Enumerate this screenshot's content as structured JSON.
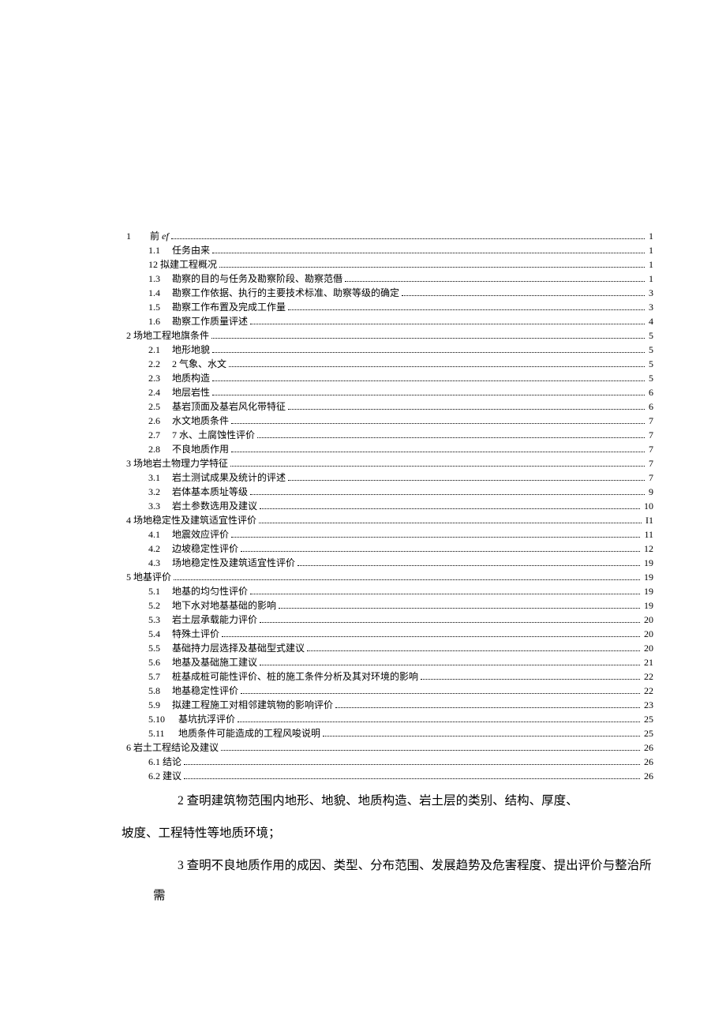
{
  "toc": [
    {
      "num": "1",
      "label": "前 <em>ef</em>",
      "page": "1",
      "lvl": 0
    },
    {
      "num": "1.1",
      "label": "任务由来",
      "page": "1",
      "lvl": 1
    },
    {
      "num": "",
      "label": "12 拟建工程概况",
      "page": "1",
      "lvl": 1
    },
    {
      "num": "1.3",
      "label": "勘察的目的与任务及勘察阶段、勘察范僭",
      "page": "1",
      "lvl": 1
    },
    {
      "num": "1.4",
      "label": "勘察工作依据、执行的主要技术标准、助察等级的确定",
      "page": "3",
      "lvl": 1
    },
    {
      "num": "1.5",
      "label": "勘察工作布置及完成工作量",
      "page": "3",
      "lvl": 1
    },
    {
      "num": "1.6",
      "label": "勘察工作质量评述",
      "page": "4",
      "lvl": 1
    },
    {
      "num": "",
      "label": "2 场地工程地旗条件",
      "page": "5",
      "lvl": 0
    },
    {
      "num": "2.1",
      "label": "地形地貌",
      "page": "5",
      "lvl": 1
    },
    {
      "num": "2.2",
      "label": "2 气象、水文",
      "page": "5",
      "lvl": 1
    },
    {
      "num": "2.3",
      "label": "地质构造",
      "page": "5",
      "lvl": 1
    },
    {
      "num": "2.4",
      "label": "地层岩性",
      "page": "6",
      "lvl": 1
    },
    {
      "num": "2.5",
      "label": "基岩顶面及基岩风化带特征",
      "page": "6",
      "lvl": 1
    },
    {
      "num": "2.6",
      "label": "水文地质条件",
      "page": "7",
      "lvl": 1
    },
    {
      "num": "2.7",
      "label": "7 水、土腐蚀性评价",
      "page": "7",
      "lvl": 1
    },
    {
      "num": "2.8",
      "label": "不良地质作用",
      "page": "7",
      "lvl": 1
    },
    {
      "num": "",
      "label": "3 场地岩土物理力学特征",
      "page": "7",
      "lvl": 0
    },
    {
      "num": "3.1",
      "label": "岩土测试成果及统计的评述",
      "page": "7",
      "lvl": 1
    },
    {
      "num": "3.2",
      "label": "岩体基本质址等级",
      "page": "9",
      "lvl": 1
    },
    {
      "num": "3.3",
      "label": "岩土参数选用及建议",
      "page": "10",
      "lvl": 1
    },
    {
      "num": "",
      "label": "4 场地稳定性及建筑适宜性评价",
      "page": "I1",
      "lvl": 0
    },
    {
      "num": "4.1",
      "label": "地震效应评价",
      "page": "11",
      "lvl": 1
    },
    {
      "num": "4.2",
      "label": "边坡稳定性评价",
      "page": "12",
      "lvl": 1
    },
    {
      "num": "4.3",
      "label": "场地稳定性及建筑适宜性评价",
      "page": "19",
      "lvl": 1
    },
    {
      "num": "",
      "label": "5 地基评价",
      "page": "19",
      "lvl": 0
    },
    {
      "num": "5.1",
      "label": "地基的均匀性评价",
      "page": "19",
      "lvl": 1
    },
    {
      "num": "5.2",
      "label": "地下水对地基基础的影响",
      "page": "19",
      "lvl": 1
    },
    {
      "num": "5.3",
      "label": "岩土层承载能力评价",
      "page": "20",
      "lvl": 1
    },
    {
      "num": "5.4",
      "label": "特殊土评价",
      "page": "20",
      "lvl": 1
    },
    {
      "num": "5.5",
      "label": "基础持力层选择及基础型式建议",
      "page": "20",
      "lvl": 1
    },
    {
      "num": "5.6",
      "label": "地基及基础施工建议",
      "page": "21",
      "lvl": 1
    },
    {
      "num": "5.7",
      "label": "桩基成桩可能性评价、桩的施工条件分析及其对环境的影响",
      "page": "22",
      "lvl": 1
    },
    {
      "num": "5.8",
      "label": "地基稳定性评价",
      "page": "22",
      "lvl": 1
    },
    {
      "num": "5.9",
      "label": "拟建工程施工对相邻建筑物的影响评价",
      "page": "23",
      "lvl": 1
    },
    {
      "num": "5.10",
      "label": "基坑抗浮评价",
      "page": "25",
      "lvl": 1
    },
    {
      "num": "5.11",
      "label": "地质条件可能造成的工程风唆说明",
      "page": "25",
      "lvl": 1
    },
    {
      "num": "",
      "label": "6 岩土工程结论及建议",
      "page": "26",
      "lvl": 0
    },
    {
      "num": "",
      "label": "6.1 结论",
      "page": "26",
      "lvl": 2
    },
    {
      "num": "",
      "label": "6.2 建议",
      "page": "26",
      "lvl": 2
    }
  ],
  "body": {
    "p1": "2 查明建筑物范围内地形、地貌、地质构造、岩土层的类别、结构、厚度、",
    "p2": "坡度、工程特性等地质环境；",
    "p3": "3 查明不良地质作用的成因、类型、分布范围、发展趋势及危害程度、提出评价与整治所需"
  }
}
